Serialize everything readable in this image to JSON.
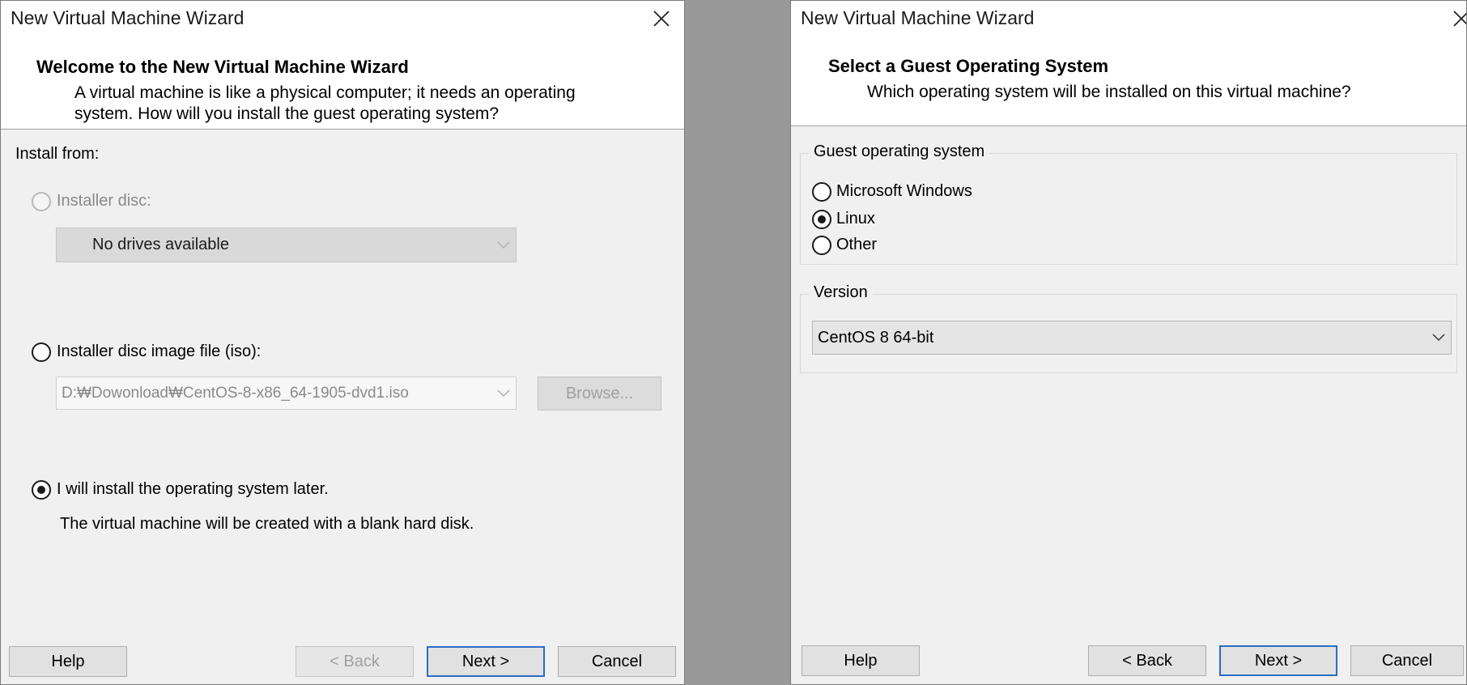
{
  "left_window": {
    "title": "New Virtual Machine Wizard",
    "header": {
      "title": "Welcome to the New Virtual Machine Wizard",
      "description": "A virtual machine is like a physical computer; it needs an operating system. How will you install the guest operating system?"
    },
    "install_from_label": "Install from:",
    "installer_disc": {
      "label": "Installer disc:",
      "selected": false,
      "enabled": false
    },
    "drive_combo": {
      "value": "No drives available"
    },
    "iso_option": {
      "label": "Installer disc image file (iso):",
      "selected": false
    },
    "iso_path": {
      "value": "D:₩Dowonload₩CentOS-8-x86_64-1905-dvd1.iso"
    },
    "browse_label": "Browse...",
    "later_option": {
      "label": "I will install the operating system later.",
      "selected": true
    },
    "later_note": "The virtual machine will be created with a blank hard disk.",
    "buttons": {
      "help": "Help",
      "back": "< Back",
      "next": "Next >",
      "cancel": "Cancel"
    }
  },
  "right_window": {
    "title": "New Virtual Machine Wizard",
    "header": {
      "title": "Select a Guest Operating System",
      "description": "Which operating system will be installed on this virtual machine?"
    },
    "guest_os_group": {
      "title": "Guest operating system",
      "options": [
        {
          "label": "Microsoft Windows",
          "selected": false
        },
        {
          "label": "Linux",
          "selected": true
        },
        {
          "label": "Other",
          "selected": false
        }
      ]
    },
    "version_group": {
      "title": "Version",
      "value": "CentOS 8 64-bit"
    },
    "buttons": {
      "help": "Help",
      "back": "< Back",
      "next": "Next >",
      "cancel": "Cancel"
    }
  },
  "icons": {
    "close": "close-icon",
    "dropdown": "chevron-down-icon"
  }
}
